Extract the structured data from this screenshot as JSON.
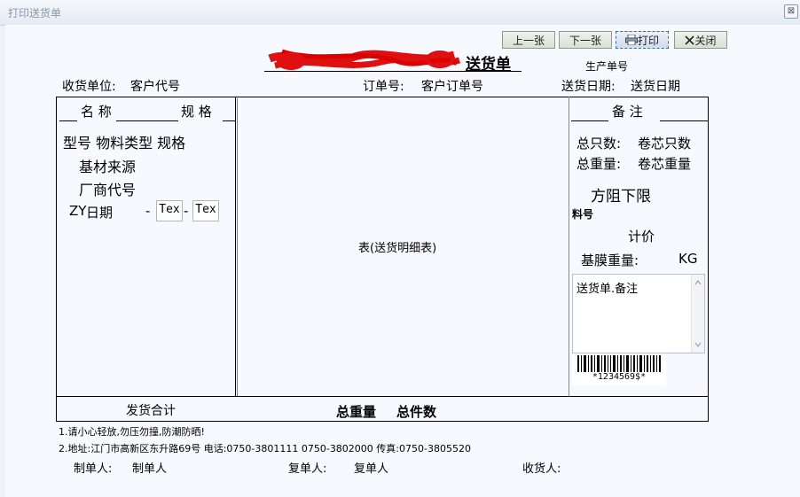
{
  "window": {
    "title": "打印送货单",
    "close_glyph": "⊠"
  },
  "toolbar": {
    "prev": "上一张",
    "next": "下一张",
    "print": "打印",
    "close": "关闭"
  },
  "header": {
    "title_tail": "送货单",
    "production_no": "生产单号",
    "consignee_label": "收货单位:",
    "consignee_value": "客户代号",
    "order_label": "订单号:",
    "order_value": "客户订单号",
    "date_label": "送货日期:",
    "date_value": "送货日期"
  },
  "left_panel": {
    "name_label": "名 称",
    "spec_label": "规 格",
    "row1": "型号  物料类型 规格",
    "row2": "基材来源",
    "row3": "厂商代号",
    "zy_label": "ZY",
    "date_label": "日期",
    "dash1": "-",
    "dash2": "-",
    "tex1": "Tex",
    "tex2": "Tex"
  },
  "center_panel": {
    "table_label": "表(送货明细表)"
  },
  "right_panel": {
    "remark_label": "备   注",
    "total_count_label": "总只数:",
    "total_count_value": "卷芯只数",
    "total_weight_label": "总重量:",
    "total_weight_value": "卷芯重量",
    "resistance": "方阻下限",
    "material_no": "料号",
    "pricing": "计价",
    "base_film_label": "基膜重量:",
    "base_film_unit": "KG",
    "memo_value": "送货单.备注",
    "barcode_text": "*1234569$*"
  },
  "footer_row": {
    "shipment_total": "发货合计",
    "total_weight": "总重量",
    "total_pieces": "总件数"
  },
  "notes": {
    "line1": "1.请小心轻放,勿压勿撞,防潮防晒!",
    "line2": "2.地址:江门市高新区东升路69号  电话:0750-3801111  0750-3802000   传真:0750-3805520"
  },
  "signatures": {
    "maker_label": "制单人:",
    "maker_value": "制单人",
    "reviewer_label": "复单人:",
    "reviewer_value": "复单人",
    "receiver_label": "收货人:"
  }
}
